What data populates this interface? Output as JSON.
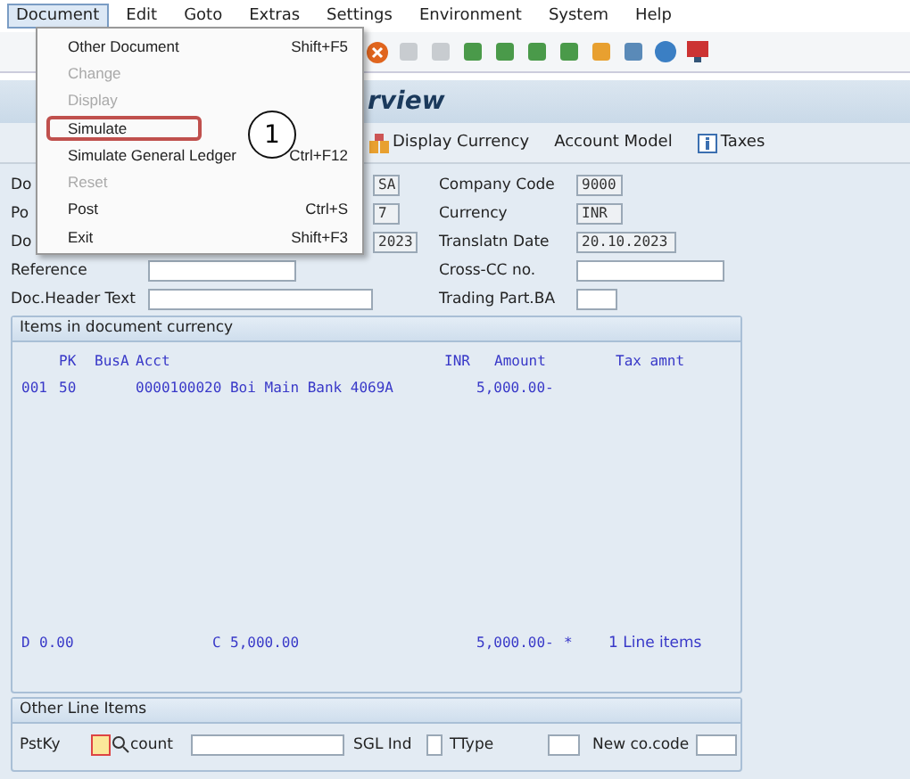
{
  "menu_bar": [
    {
      "label": "Document",
      "selected": true
    },
    {
      "label": "Edit",
      "selected": false
    },
    {
      "label": "Goto",
      "selected": false
    },
    {
      "label": "Extras",
      "selected": false
    },
    {
      "label": "Settings",
      "selected": false
    },
    {
      "label": "Environment",
      "selected": false
    },
    {
      "label": "System",
      "selected": false
    },
    {
      "label": "Help",
      "selected": false
    }
  ],
  "dropdown": [
    {
      "label": "Other Document",
      "shortcut": "Shift+F5",
      "disabled": false,
      "highlighted": false
    },
    {
      "label": "Change",
      "disabled": true,
      "highlighted": false
    },
    {
      "label": "Display",
      "disabled": true,
      "highlighted": false
    },
    {
      "label": "Simulate",
      "disabled": false,
      "highlighted": true
    },
    {
      "label": "Simulate General Ledger",
      "shortcut": "Ctrl+F12",
      "disabled": false,
      "highlighted": false
    },
    {
      "label": "Reset",
      "disabled": true,
      "highlighted": false
    },
    {
      "label": "Post",
      "shortcut": "Ctrl+S",
      "disabled": false,
      "highlighted": false
    },
    {
      "label": "Exit",
      "shortcut": "Shift+F3",
      "disabled": false,
      "highlighted": false
    }
  ],
  "callout": "1",
  "title": "rview",
  "app_toolbar": [
    {
      "label": "Display Currency",
      "kind": "coins"
    },
    {
      "label": "Account Model",
      "kind": "plain"
    },
    {
      "label": "Taxes",
      "kind": "info"
    }
  ],
  "header_rows": [
    {
      "label": "Do",
      "value": "SA",
      "right_label": "Company Code",
      "right_value": "9000"
    },
    {
      "label": "Po",
      "value": "7",
      "right_label": "Currency",
      "right_value": "INR"
    },
    {
      "label": "Do",
      "value": "2023",
      "right_label": "Translatn Date",
      "right_value": "20.10.2023"
    }
  ],
  "reference": {
    "label": "Reference",
    "right_label": "Cross-CC no."
  },
  "header_text": {
    "label": "Doc.Header Text",
    "right_label": "Trading Part.BA"
  },
  "items": {
    "title": "Items in document currency",
    "columns": [
      "PK",
      "BusA",
      "Acct",
      "INR",
      "Amount",
      "Tax amnt"
    ],
    "rows": [
      {
        "line": "001",
        "pk": "50",
        "acct": "0000100020 Boi Main Bank 4069A",
        "amount": "5,000.00-"
      }
    ],
    "debit_label": "D",
    "debit": "0.00",
    "credit_label": "C",
    "credit": "5,000.00",
    "balance": "5,000.00-",
    "balance_mark": "*",
    "count": "1 Line items"
  },
  "other_items": {
    "title": "Other Line Items",
    "fields": [
      "PstKy",
      "count",
      "SGL Ind",
      "TType",
      "New co.code"
    ]
  }
}
